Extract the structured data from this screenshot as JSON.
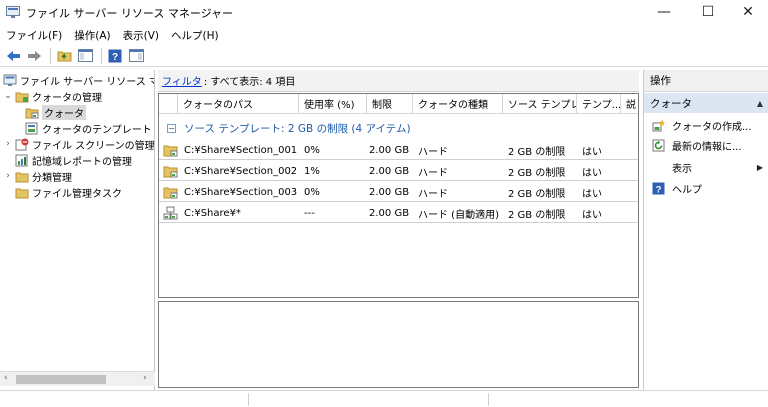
{
  "window": {
    "title": "ファイル サーバー リソース マネージャー",
    "controls": {
      "minimize": "—",
      "maximize": "☐",
      "close": "✕"
    }
  },
  "menu": [
    {
      "label": "ファイル(F)"
    },
    {
      "label": "操作(A)"
    },
    {
      "label": "表示(V)"
    },
    {
      "label": "ヘルプ(H)"
    }
  ],
  "toolbar": {
    "icons": [
      "back-arrow-icon",
      "forward-arrow-icon",
      "up-folder-icon",
      "show-hide-tree-icon",
      "help-icon",
      "properties-icon"
    ]
  },
  "tree": {
    "items": [
      {
        "label": "ファイル サーバー リソース マネージ",
        "toggle": "",
        "icon": "fsrm-root-icon"
      },
      {
        "label": "クォータの管理",
        "toggle": "⌄",
        "icon": "quota-management-icon"
      },
      {
        "label": "クォータ",
        "toggle": "",
        "icon": "quota-folder-icon",
        "selected": true
      },
      {
        "label": "クォータのテンプレート",
        "toggle": "",
        "icon": "quota-template-icon"
      },
      {
        "label": "ファイル スクリーンの管理",
        "toggle": "›",
        "icon": "file-screen-icon"
      },
      {
        "label": "記憶域レポートの管理",
        "toggle": "",
        "icon": "storage-report-icon"
      },
      {
        "label": "分類管理",
        "toggle": "›",
        "icon": "classification-icon"
      },
      {
        "label": "ファイル管理タスク",
        "toggle": "",
        "icon": "file-task-icon"
      }
    ],
    "scroll_left": "‹",
    "scroll_right": "›"
  },
  "center": {
    "filter_link": "フィルタ",
    "filter_text": ": すべて表示: 4 項目",
    "columns": [
      {
        "label": "クォータのパス"
      },
      {
        "label": "使用率 (%)"
      },
      {
        "label": "制限"
      },
      {
        "label": "クォータの種類"
      },
      {
        "label": "ソース テンプレ..."
      },
      {
        "label": "テンプ..."
      },
      {
        "label": "説"
      }
    ],
    "group": {
      "toggle": "−",
      "label": "ソース テンプレート: 2 GB の制限 (4 アイテム)"
    },
    "rows": [
      {
        "path": "C:¥Share¥Section_001",
        "usage": "0%",
        "limit": "2.00 GB",
        "type": "ハード",
        "template": "2 GB の制限",
        "match": "はい",
        "icon": "quota-folder-icon"
      },
      {
        "path": "C:¥Share¥Section_002",
        "usage": "1%",
        "limit": "2.00 GB",
        "type": "ハード",
        "template": "2 GB の制限",
        "match": "はい",
        "icon": "quota-folder-icon"
      },
      {
        "path": "C:¥Share¥Section_003",
        "usage": "0%",
        "limit": "2.00 GB",
        "type": "ハード",
        "template": "2 GB の制限",
        "match": "はい",
        "icon": "quota-folder-icon"
      },
      {
        "path": "C:¥Share¥*",
        "usage": "---",
        "limit": "2.00 GB",
        "type": "ハード (自動適用)",
        "template": "2 GB の制限",
        "match": "はい",
        "icon": "auto-apply-quota-icon"
      }
    ]
  },
  "actions": {
    "header": "操作",
    "section": "クォータ",
    "section_toggle": "▲",
    "items": [
      {
        "label": "クォータの作成...",
        "icon": "create-quota-icon",
        "submenu": ""
      },
      {
        "label": "最新の情報に...",
        "icon": "refresh-icon",
        "submenu": ""
      },
      {
        "label": "表示",
        "icon": "",
        "submenu": "▶"
      },
      {
        "label": "ヘルプ",
        "icon": "help-icon",
        "submenu": ""
      }
    ]
  },
  "colors": {
    "accent": "#1e5aa8",
    "link": "#0033cc",
    "selection": "#d9d9d9",
    "actions_section": "#dce6f3"
  }
}
